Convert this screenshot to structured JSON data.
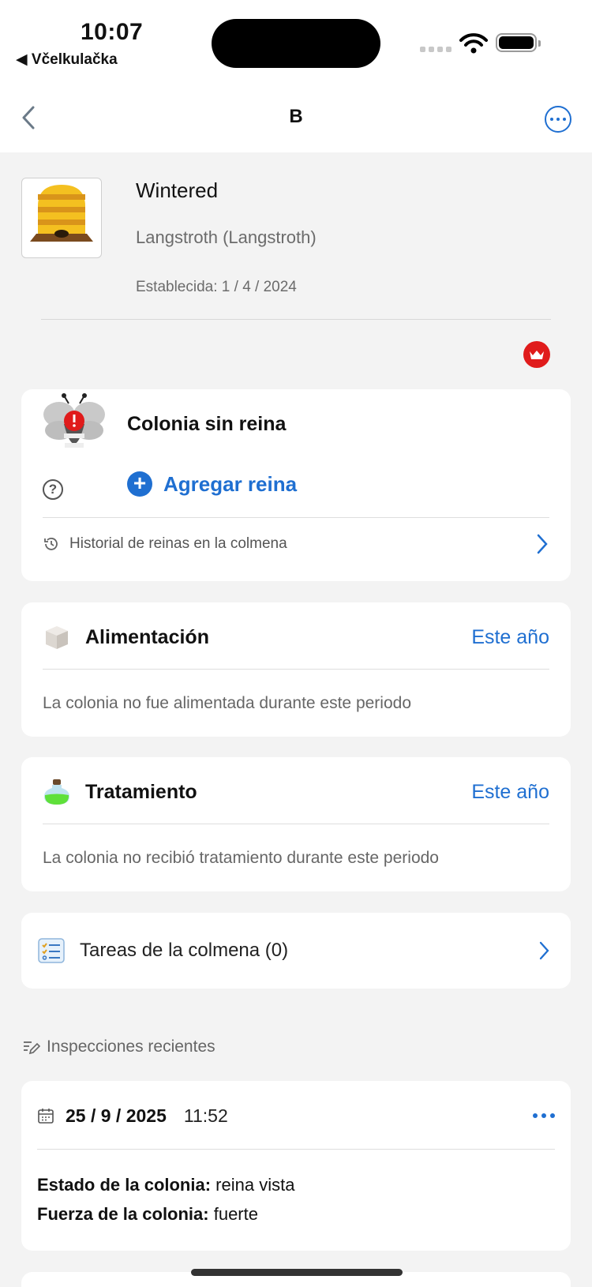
{
  "status_bar": {
    "time": "10:07",
    "back_app": "◀ Včelkulačka"
  },
  "nav": {
    "title": "B"
  },
  "hive": {
    "name": "Wintered",
    "type": "Langstroth (Langstroth)",
    "established": "Establecida: 1 / 4 / 2024"
  },
  "queen": {
    "title": "Colonia sin reina",
    "add_label": "Agregar reina",
    "history_label": "Historial de reinas en la colmena"
  },
  "feeding": {
    "title": "Alimentación",
    "period": "Este año",
    "empty": "La colonia no fue alimentada durante este periodo"
  },
  "treatment": {
    "title": "Tratamiento",
    "period": "Este año",
    "empty": "La colonia no recibió tratamiento durante este periodo"
  },
  "tasks": {
    "label": "Tareas de la colmena (0)"
  },
  "inspections": {
    "heading": "Inspecciones recientes",
    "items": [
      {
        "date": "25 / 9 / 2025",
        "time": "11:52",
        "status_label": "Estado de la colonia:",
        "status_value": " reina vista",
        "strength_label": "Fuerza de la colonia:",
        "strength_value": " fuerte"
      }
    ]
  },
  "colors": {
    "accent": "#1f6fd1",
    "alert": "#e01b1b",
    "background": "#f3f3f3"
  }
}
